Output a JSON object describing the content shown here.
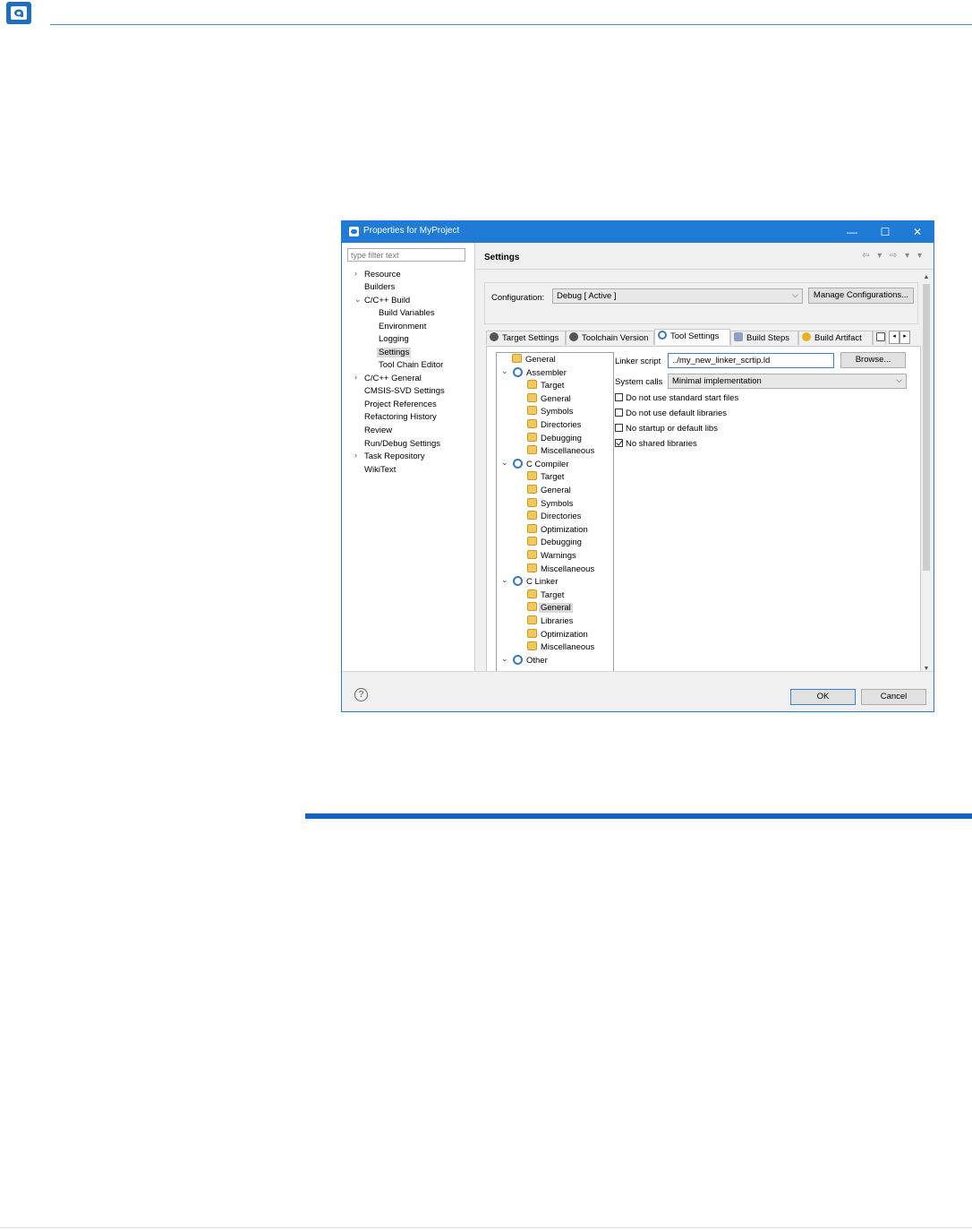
{
  "window": {
    "title": "Properties for MyProject",
    "accent": "#1f7bd6"
  },
  "left": {
    "filter_placeholder": "type filter text",
    "items": [
      {
        "label": "Resource",
        "chevron": "›"
      },
      {
        "label": "Builders",
        "chevron": ""
      },
      {
        "label": "C/C++ Build",
        "chevron": "⌄"
      },
      {
        "label": "Build Variables",
        "chevron": ""
      },
      {
        "label": "Environment",
        "chevron": ""
      },
      {
        "label": "Logging",
        "chevron": ""
      },
      {
        "label": "Settings",
        "chevron": ""
      },
      {
        "label": "Tool Chain Editor",
        "chevron": ""
      },
      {
        "label": "C/C++ General",
        "chevron": "›"
      },
      {
        "label": "CMSIS-SVD Settings",
        "chevron": ""
      },
      {
        "label": "Project References",
        "chevron": ""
      },
      {
        "label": "Refactoring History",
        "chevron": ""
      },
      {
        "label": "Review",
        "chevron": ""
      },
      {
        "label": "Run/Debug Settings",
        "chevron": ""
      },
      {
        "label": "Task Repository",
        "chevron": "›"
      },
      {
        "label": "WikiText",
        "chevron": ""
      }
    ]
  },
  "right": {
    "title": "Settings",
    "nav_arrows": "⇦ ▾ ⇨ ▾ ▾",
    "config_label": "Configuration:",
    "config_value": "Debug  [ Active ]",
    "manage_label": "Manage Configurations...",
    "tabs": [
      "Target Settings",
      "Toolchain Version",
      "Tool Settings",
      "Build Steps",
      "Build Artifact"
    ],
    "tree": [
      {
        "label": "General"
      },
      {
        "label": "Assembler",
        "chevron": "⌄"
      },
      {
        "label": "Target"
      },
      {
        "label": "General"
      },
      {
        "label": "Symbols"
      },
      {
        "label": "Directories"
      },
      {
        "label": "Debugging"
      },
      {
        "label": "Miscellaneous"
      },
      {
        "label": "C Compiler",
        "chevron": "⌄"
      },
      {
        "label": "Target"
      },
      {
        "label": "General"
      },
      {
        "label": "Symbols"
      },
      {
        "label": "Directories"
      },
      {
        "label": "Optimization"
      },
      {
        "label": "Debugging"
      },
      {
        "label": "Warnings"
      },
      {
        "label": "Miscellaneous"
      },
      {
        "label": "C Linker",
        "chevron": "⌄"
      },
      {
        "label": "Target"
      },
      {
        "label": "General"
      },
      {
        "label": "Libraries"
      },
      {
        "label": "Optimization"
      },
      {
        "label": "Miscellaneous"
      },
      {
        "label": "Other",
        "chevron": "⌄"
      }
    ],
    "linker_label": "Linker script",
    "linker_value": "../my_new_linker_scrtip.ld",
    "browse_label": "Browse...",
    "syscalls_label": "System calls",
    "syscalls_value": "Minimal implementation",
    "checks": [
      {
        "label": "Do not use standard start files",
        "checked": false
      },
      {
        "label": "Do not use default libraries",
        "checked": false
      },
      {
        "label": "No startup or default libs",
        "checked": false
      },
      {
        "label": "No shared libraries",
        "checked": true
      }
    ]
  },
  "footer": {
    "help": "?",
    "ok": "OK",
    "cancel": "Cancel"
  }
}
